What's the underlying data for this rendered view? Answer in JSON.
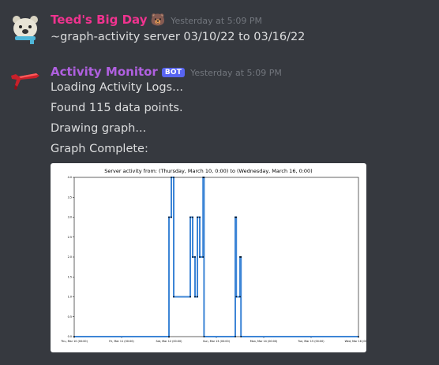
{
  "messages": [
    {
      "username": "Teed's Big Day",
      "username_color": "#f0338f",
      "emoji": "🐻",
      "timestamp": "Yesterday at 5:09 PM",
      "lines": [
        "~graph-activity server 03/10/22 to 03/16/22"
      ]
    },
    {
      "username": "Activity Monitor",
      "username_color": "#b060e0",
      "tag": "BOT",
      "timestamp": "Yesterday at 5:09 PM",
      "lines": [
        "Loading Activity Logs...",
        "Found 115 data points.",
        "Drawing graph...",
        "Graph Complete:"
      ]
    }
  ],
  "chart_data": {
    "type": "line",
    "title": "Server activity from: (Thursday, March 10, 0:00) to (Wednesday, March 16, 0:00)",
    "xlabel": "",
    "ylabel": "",
    "x_ticks": [
      "Thu, Mar 10 (00:00)",
      "Fri, Mar 11 (00:00)",
      "Sat, Mar 12 (00:00)",
      "Sun, Mar 13 (00:00)",
      "Mon, Mar 14 (00:00)",
      "Tue, Mar 15 (00:00)",
      "Wed, Mar 16 (00:00)"
    ],
    "y_ticks": [
      "0.0",
      "0.5",
      "1.0",
      "1.5",
      "2.0",
      "2.5",
      "3.0",
      "3.5",
      "4.0"
    ],
    "ylim": [
      0,
      4
    ],
    "xlim_days": [
      0,
      6
    ],
    "grid": false,
    "line_color": "#3d85d6",
    "series": [
      {
        "points": [
          [
            0.0,
            0
          ],
          [
            2.0,
            0
          ],
          [
            2.0,
            3
          ],
          [
            2.05,
            3
          ],
          [
            2.05,
            4
          ],
          [
            2.1,
            4
          ],
          [
            2.1,
            1
          ],
          [
            2.45,
            1
          ],
          [
            2.45,
            3
          ],
          [
            2.5,
            3
          ],
          [
            2.5,
            2
          ],
          [
            2.55,
            2
          ],
          [
            2.55,
            1
          ],
          [
            2.6,
            1
          ],
          [
            2.6,
            3
          ],
          [
            2.65,
            3
          ],
          [
            2.65,
            2
          ],
          [
            2.72,
            2
          ],
          [
            2.72,
            4
          ],
          [
            2.74,
            4
          ],
          [
            2.74,
            0
          ],
          [
            3.4,
            0
          ],
          [
            3.4,
            3
          ],
          [
            3.42,
            3
          ],
          [
            3.42,
            1
          ],
          [
            3.5,
            1
          ],
          [
            3.5,
            2
          ],
          [
            3.52,
            2
          ],
          [
            3.52,
            0
          ],
          [
            6.0,
            0
          ]
        ]
      }
    ]
  }
}
